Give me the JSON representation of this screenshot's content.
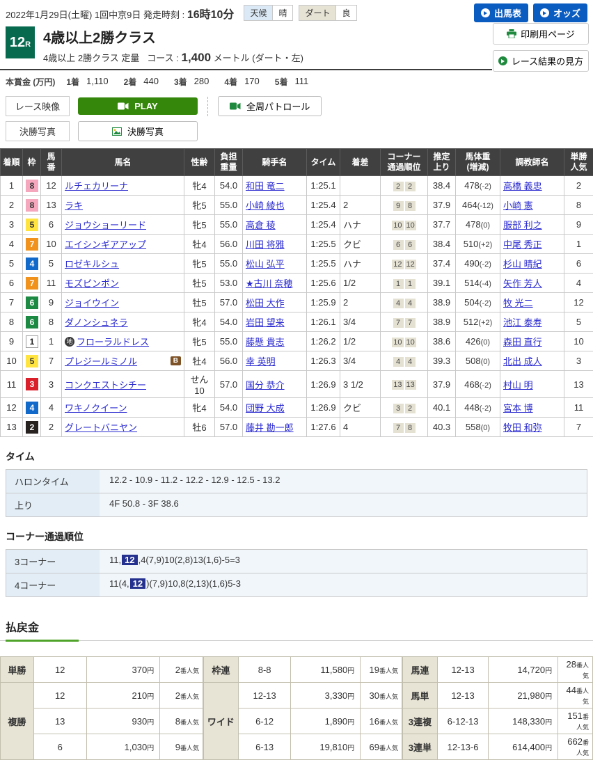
{
  "header": {
    "date_line": "2022年1月29日(土曜)  1回中京9日",
    "start_label": "発走時刻 :",
    "start_time": "16時10分",
    "weather_label": "天候",
    "weather_value": "晴",
    "track_label": "ダート",
    "track_value": "良",
    "btn_shutsubahyo": "出馬表",
    "btn_odds": "オッズ",
    "btn_print": "印刷用ページ",
    "btn_guide": "レース結果の見方",
    "race_no": "12",
    "race_no_sub": "R",
    "race_title": "4歳以上2勝クラス",
    "race_cond": "4歳以上  2勝クラス  定量",
    "course_label": "コース :",
    "course_value": "1,400",
    "course_suffix": "メートル (ダート・左)",
    "prize_label": "本賞金 (万円)",
    "prize_items": [
      {
        "place": "1着",
        "amount": "1,110"
      },
      {
        "place": "2着",
        "amount": "440"
      },
      {
        "place": "3着",
        "amount": "280"
      },
      {
        "place": "4着",
        "amount": "170"
      },
      {
        "place": "5着",
        "amount": "111"
      }
    ]
  },
  "media": {
    "video_label": "レース映像",
    "play_label": "PLAY",
    "patrol_label": "全周パトロール",
    "photo_label": "決勝写真",
    "photo_btn": "決勝写真"
  },
  "results": {
    "headers": [
      "着順",
      "枠",
      "馬\n番",
      "馬名",
      "性齢",
      "負担\n重量",
      "騎手名",
      "タイム",
      "着差",
      "コーナー\n通過順位",
      "推定\n上り",
      "馬体重\n(増減)",
      "調教師名",
      "単勝\n人気"
    ],
    "rows": [
      {
        "pos": "1",
        "waku": "w8",
        "num": "12",
        "mark": "",
        "horse": "ルチェカリーナ",
        "badge": "",
        "sexage": "牝4",
        "load": "54.0",
        "jockey": "和田 竜二",
        "time": "1:25.1",
        "margin": "",
        "c1": "2",
        "c2": "2",
        "agari": "38.4",
        "wt": "478",
        "wtd": "(-2)",
        "trainer": "高橋 義忠",
        "fav": "2"
      },
      {
        "pos": "2",
        "waku": "w8",
        "num": "13",
        "mark": "",
        "horse": "ラキ",
        "badge": "",
        "sexage": "牝5",
        "load": "55.0",
        "jockey": "小崎 綾也",
        "time": "1:25.4",
        "margin": "2",
        "c1": "9",
        "c2": "8",
        "agari": "37.9",
        "wt": "464",
        "wtd": "(-12)",
        "trainer": "小崎 憲",
        "fav": "8"
      },
      {
        "pos": "3",
        "waku": "w5",
        "num": "6",
        "mark": "",
        "horse": "ジョウショーリード",
        "badge": "",
        "sexage": "牝5",
        "load": "55.0",
        "jockey": "高倉 稜",
        "time": "1:25.4",
        "margin": "ハナ",
        "c1": "10",
        "c2": "10",
        "agari": "37.7",
        "wt": "478",
        "wtd": "(0)",
        "trainer": "服部 利之",
        "fav": "9"
      },
      {
        "pos": "4",
        "waku": "w7",
        "num": "10",
        "mark": "",
        "horse": "エイシンギアアップ",
        "badge": "",
        "sexage": "牡4",
        "load": "56.0",
        "jockey": "川田 将雅",
        "time": "1:25.5",
        "margin": "クビ",
        "c1": "6",
        "c2": "6",
        "agari": "38.4",
        "wt": "510",
        "wtd": "(+2)",
        "trainer": "中尾 秀正",
        "fav": "1"
      },
      {
        "pos": "5",
        "waku": "w4",
        "num": "5",
        "mark": "",
        "horse": "ロゼキルシュ",
        "badge": "",
        "sexage": "牝5",
        "load": "55.0",
        "jockey": "松山 弘平",
        "time": "1:25.5",
        "margin": "ハナ",
        "c1": "12",
        "c2": "12",
        "agari": "37.4",
        "wt": "490",
        "wtd": "(-2)",
        "trainer": "杉山 晴紀",
        "fav": "6"
      },
      {
        "pos": "6",
        "waku": "w7",
        "num": "11",
        "mark": "",
        "horse": "モズピンポン",
        "badge": "",
        "sexage": "牡5",
        "load": "53.0",
        "jockey": "★古川 奈穂",
        "time": "1:25.6",
        "margin": "1/2",
        "c1": "1",
        "c2": "1",
        "agari": "39.1",
        "wt": "514",
        "wtd": "(-4)",
        "trainer": "矢作 芳人",
        "fav": "4"
      },
      {
        "pos": "7",
        "waku": "w6",
        "num": "9",
        "mark": "",
        "horse": "ジョイウイン",
        "badge": "",
        "sexage": "牡5",
        "load": "57.0",
        "jockey": "松田 大作",
        "time": "1:25.9",
        "margin": "2",
        "c1": "4",
        "c2": "4",
        "agari": "38.9",
        "wt": "504",
        "wtd": "(-2)",
        "trainer": "牧 光二",
        "fav": "12"
      },
      {
        "pos": "8",
        "waku": "w6",
        "num": "8",
        "mark": "",
        "horse": "ダノンシュネラ",
        "badge": "",
        "sexage": "牝4",
        "load": "54.0",
        "jockey": "岩田 望来",
        "time": "1:26.1",
        "margin": "3/4",
        "c1": "7",
        "c2": "7",
        "agari": "38.9",
        "wt": "512",
        "wtd": "(+2)",
        "trainer": "池江 泰寿",
        "fav": "5"
      },
      {
        "pos": "9",
        "waku": "w1",
        "num": "1",
        "mark": "地",
        "horse": "フローラルドレス",
        "badge": "",
        "sexage": "牝5",
        "load": "55.0",
        "jockey": "藤懸 貴志",
        "time": "1:26.2",
        "margin": "1/2",
        "c1": "10",
        "c2": "10",
        "agari": "38.6",
        "wt": "426",
        "wtd": "(0)",
        "trainer": "森田 直行",
        "fav": "10"
      },
      {
        "pos": "10",
        "waku": "w5",
        "num": "7",
        "mark": "",
        "horse": "プレジールミノル",
        "badge": "B",
        "sexage": "牡4",
        "load": "56.0",
        "jockey": "幸 英明",
        "time": "1:26.3",
        "margin": "3/4",
        "c1": "4",
        "c2": "4",
        "agari": "39.3",
        "wt": "508",
        "wtd": "(0)",
        "trainer": "北出 成人",
        "fav": "3"
      },
      {
        "pos": "11",
        "waku": "w3",
        "num": "3",
        "mark": "",
        "horse": "コンクエストシチー",
        "badge": "",
        "sexage": "せん10",
        "load": "57.0",
        "jockey": "国分 恭介",
        "time": "1:26.9",
        "margin": "3 1/2",
        "c1": "13",
        "c2": "13",
        "agari": "37.9",
        "wt": "468",
        "wtd": "(-2)",
        "trainer": "村山 明",
        "fav": "13"
      },
      {
        "pos": "12",
        "waku": "w4",
        "num": "4",
        "mark": "",
        "horse": "ワキノクイーン",
        "badge": "",
        "sexage": "牝4",
        "load": "54.0",
        "jockey": "団野 大成",
        "time": "1:26.9",
        "margin": "クビ",
        "c1": "3",
        "c2": "2",
        "agari": "40.1",
        "wt": "448",
        "wtd": "(-2)",
        "trainer": "宮本 博",
        "fav": "11"
      },
      {
        "pos": "13",
        "waku": "w2",
        "num": "2",
        "mark": "",
        "horse": "グレートバニヤン",
        "badge": "",
        "sexage": "牡6",
        "load": "57.0",
        "jockey": "藤井 勘一郎",
        "time": "1:27.6",
        "margin": "4",
        "c1": "7",
        "c2": "8",
        "agari": "40.3",
        "wt": "558",
        "wtd": "(0)",
        "trainer": "牧田 和弥",
        "fav": "7"
      }
    ]
  },
  "time_section": {
    "heading": "タイム",
    "rows": [
      {
        "label": "ハロンタイム",
        "value": "12.2 - 10.9 - 11.2 - 12.2 - 12.9 - 12.5 - 13.2"
      },
      {
        "label": "上り",
        "value": "4F 50.8 - 3F 38.6"
      }
    ]
  },
  "corner_section": {
    "heading": "コーナー通過順位",
    "rows": [
      {
        "label": "3コーナー",
        "pre": "11,",
        "hl": "12",
        "post": ",4(7,9)10(2,8)13(1,6)-5=3"
      },
      {
        "label": "4コーナー",
        "pre": "11(4,",
        "hl": "12",
        "post": ")(7,9)10,8(2,13)(1,6)5-3"
      }
    ]
  },
  "payout": {
    "heading": "払戻金",
    "unit_yen": "円",
    "unit_fav": "番人気",
    "tansho": {
      "label": "単勝",
      "rows": [
        {
          "combo": "12",
          "amount": "370",
          "fav": "2"
        }
      ]
    },
    "fukusho": {
      "label": "複勝",
      "rows": [
        {
          "combo": "12",
          "amount": "210",
          "fav": "2"
        },
        {
          "combo": "13",
          "amount": "930",
          "fav": "8"
        },
        {
          "combo": "6",
          "amount": "1,030",
          "fav": "9"
        }
      ]
    },
    "wakuren": {
      "label": "枠連",
      "rows": [
        {
          "combo": "8-8",
          "amount": "11,580",
          "fav": "19"
        }
      ]
    },
    "wide": {
      "label": "ワイド",
      "rows": [
        {
          "combo": "12-13",
          "amount": "3,330",
          "fav": "30"
        },
        {
          "combo": "6-12",
          "amount": "1,890",
          "fav": "16"
        },
        {
          "combo": "6-13",
          "amount": "19,810",
          "fav": "69"
        }
      ]
    },
    "umaren": {
      "label": "馬連",
      "rows": [
        {
          "combo": "12-13",
          "amount": "14,720",
          "fav": "28"
        }
      ]
    },
    "umatan": {
      "label": "馬単",
      "rows": [
        {
          "combo": "12-13",
          "amount": "21,980",
          "fav": "44"
        }
      ]
    },
    "sanrenpuku": {
      "label": "3連複",
      "rows": [
        {
          "combo": "6-12-13",
          "amount": "148,330",
          "fav": "151"
        }
      ]
    },
    "sanrentan": {
      "label": "3連単",
      "rows": [
        {
          "combo": "12-13-6",
          "amount": "614,400",
          "fav": "662"
        }
      ]
    }
  }
}
